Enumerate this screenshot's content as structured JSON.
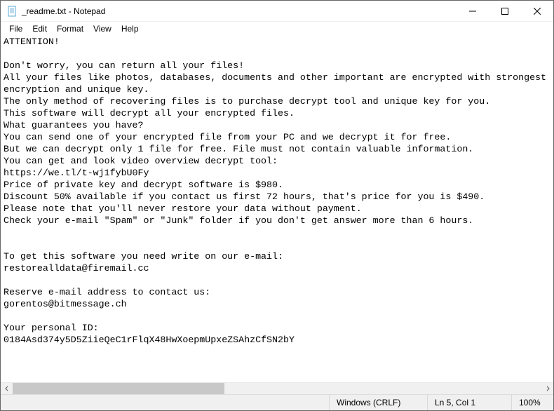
{
  "window": {
    "title": "_readme.txt - Notepad"
  },
  "menu": {
    "file": "File",
    "edit": "Edit",
    "format": "Format",
    "view": "View",
    "help": "Help"
  },
  "document": {
    "body": "ATTENTION!\n\nDon't worry, you can return all your files!\nAll your files like photos, databases, documents and other important are encrypted with strongest encryption and unique key.\nThe only method of recovering files is to purchase decrypt tool and unique key for you.\nThis software will decrypt all your encrypted files.\nWhat guarantees you have?\nYou can send one of your encrypted file from your PC and we decrypt it for free.\nBut we can decrypt only 1 file for free. File must not contain valuable information.\nYou can get and look video overview decrypt tool:\nhttps://we.tl/t-wj1fybU0Fy\nPrice of private key and decrypt software is $980.\nDiscount 50% available if you contact us first 72 hours, that's price for you is $490.\nPlease note that you'll never restore your data without payment.\nCheck your e-mail \"Spam\" or \"Junk\" folder if you don't get answer more than 6 hours.\n\n\nTo get this software you need write on our e-mail:\nrestorealldata@firemail.cc\n\nReserve e-mail address to contact us:\ngorentos@bitmessage.ch\n\nYour personal ID:\n0184Asd374y5D5ZiieQeC1rFlqX48HwXoepmUpxeZSAhzCfSN2bY"
  },
  "statusbar": {
    "line_ending": "Windows (CRLF)",
    "position": "Ln 5, Col 1",
    "zoom": "100%"
  }
}
